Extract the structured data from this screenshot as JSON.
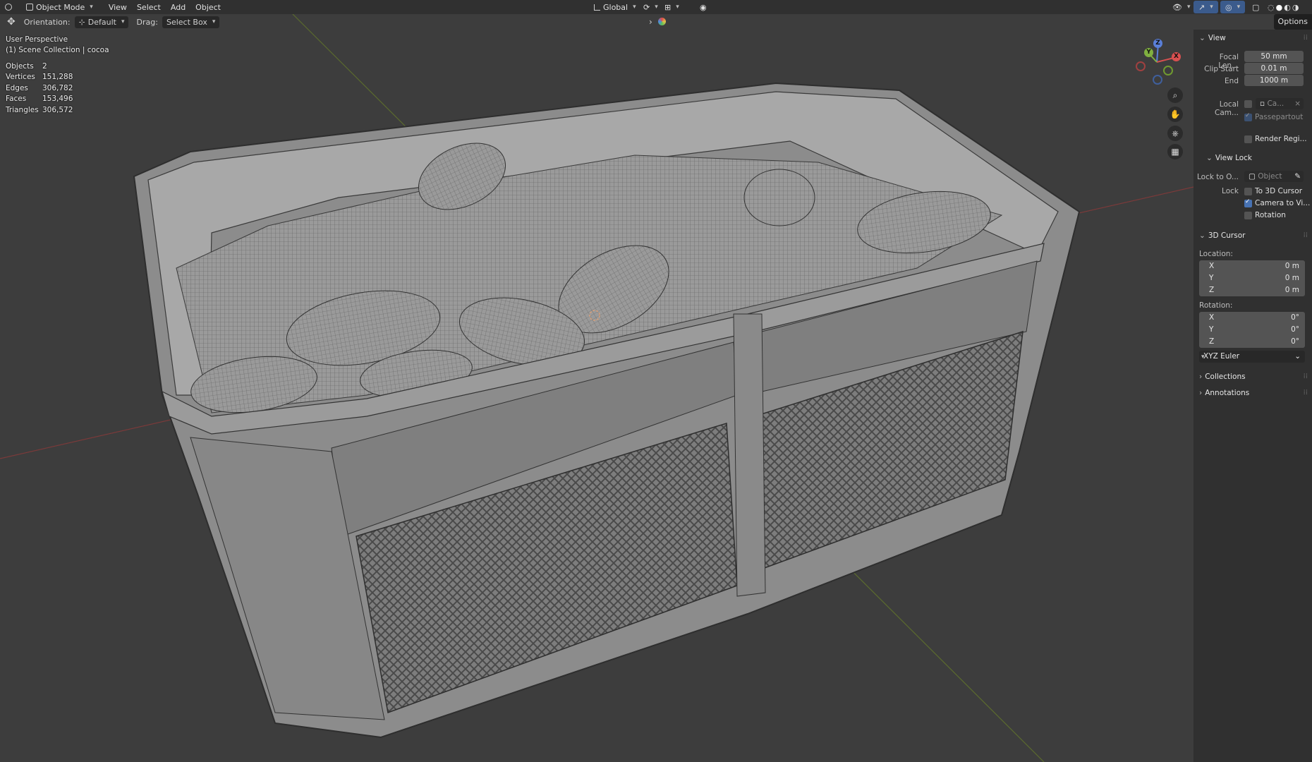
{
  "header": {
    "mode": "Object Mode",
    "menus": [
      "View",
      "Select",
      "Add",
      "Object"
    ],
    "transform_orientation": "Global"
  },
  "toolbar": {
    "orientation_label": "Orientation:",
    "orientation_value": "Default",
    "drag_label": "Drag:",
    "drag_value": "Select Box",
    "options_label": "Options"
  },
  "overlay": {
    "view_name": "User Perspective",
    "collection": "(1) Scene Collection | cocoa",
    "stats": [
      {
        "label": "Objects",
        "value": "2"
      },
      {
        "label": "Vertices",
        "value": "151,288"
      },
      {
        "label": "Edges",
        "value": "306,782"
      },
      {
        "label": "Faces",
        "value": "153,496"
      },
      {
        "label": "Triangles",
        "value": "306,572"
      }
    ]
  },
  "gizmo": {
    "x": "X",
    "y": "Y",
    "z": "Z"
  },
  "sidebar": {
    "view": {
      "title": "View",
      "focal_label": "Focal Len...",
      "focal_value": "50 mm",
      "clip_start_label": "Clip Start",
      "clip_start_value": "0.01 m",
      "clip_end_label": "End",
      "clip_end_value": "1000 m",
      "local_camera_label": "Local Cam...",
      "local_camera_value": "Ca...",
      "passepartout": "Passepartout",
      "render_region": "Render Regi..."
    },
    "view_lock": {
      "title": "View Lock",
      "lock_to_label": "Lock to O...",
      "lock_to_placeholder": "Object",
      "lock_label": "Lock",
      "to_cursor": "To 3D Cursor",
      "camera_to_view": "Camera to Vi...",
      "rotation": "Rotation"
    },
    "cursor": {
      "title": "3D Cursor",
      "location_label": "Location:",
      "location": [
        {
          "axis": "X",
          "value": "0 m"
        },
        {
          "axis": "Y",
          "value": "0 m"
        },
        {
          "axis": "Z",
          "value": "0 m"
        }
      ],
      "rotation_label": "Rotation:",
      "rotation": [
        {
          "axis": "X",
          "value": "0°"
        },
        {
          "axis": "Y",
          "value": "0°"
        },
        {
          "axis": "Z",
          "value": "0°"
        }
      ],
      "rotation_mode": "XYZ Euler"
    },
    "collections_title": "Collections",
    "annotations_title": "Annotations"
  }
}
